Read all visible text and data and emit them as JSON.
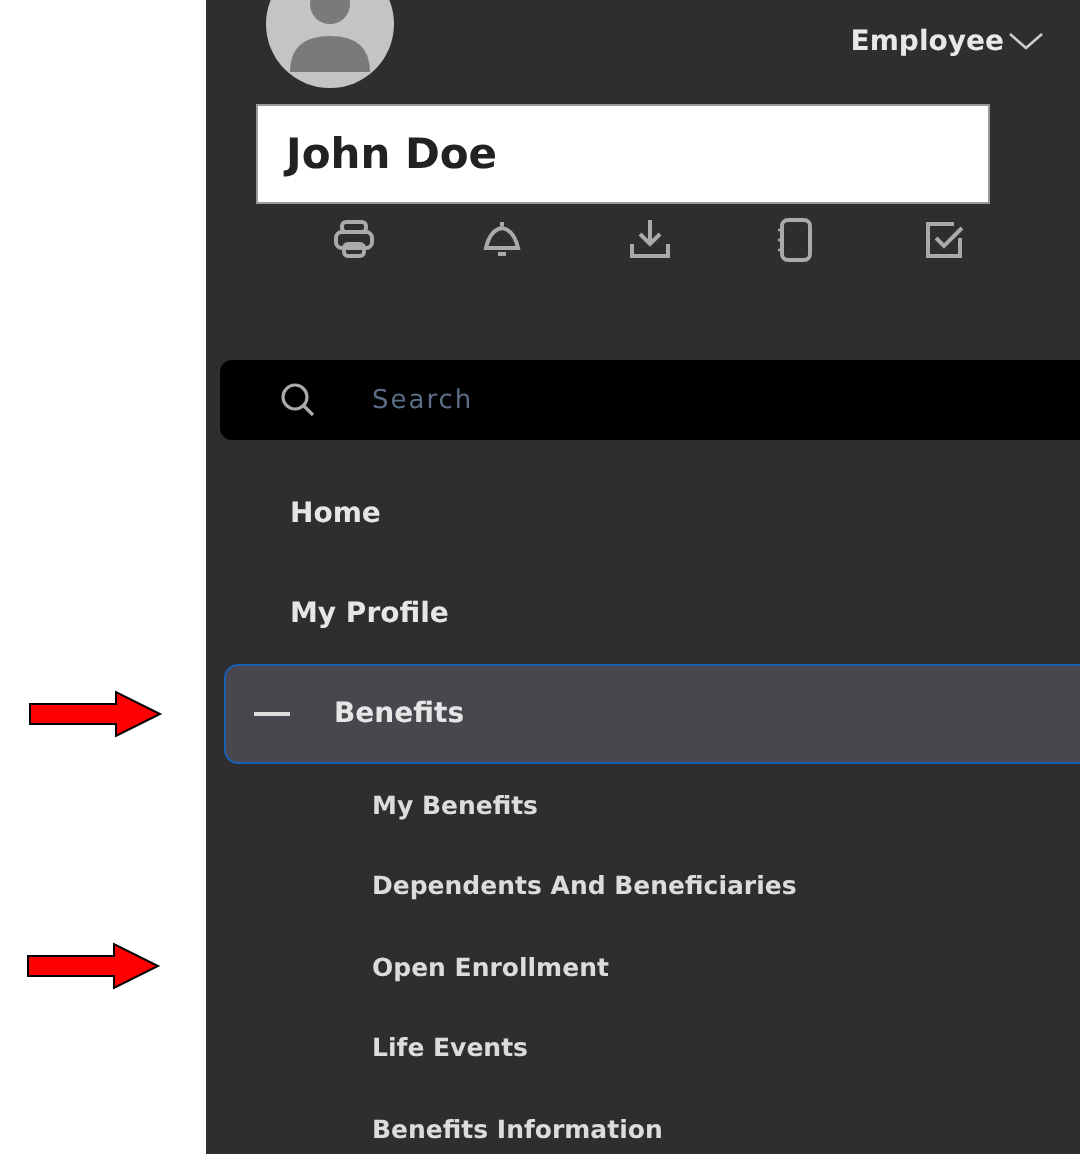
{
  "header": {
    "role": "Employee",
    "name": "John Doe"
  },
  "search": {
    "placeholder": "Search"
  },
  "nav": [
    {
      "label": "Home",
      "selected": false,
      "arrow": false
    },
    {
      "label": "My Profile",
      "selected": false,
      "arrow": false
    },
    {
      "label": "Benefits",
      "selected": true,
      "expanded": true,
      "arrow": true,
      "children": [
        {
          "label": "My Benefits",
          "arrow": false
        },
        {
          "label": "Dependents And Beneficiaries",
          "arrow": false
        },
        {
          "label": "Open Enrollment",
          "arrow": true
        },
        {
          "label": "Life Events",
          "arrow": false
        },
        {
          "label": "Benefits Information",
          "arrow": false
        }
      ]
    }
  ]
}
